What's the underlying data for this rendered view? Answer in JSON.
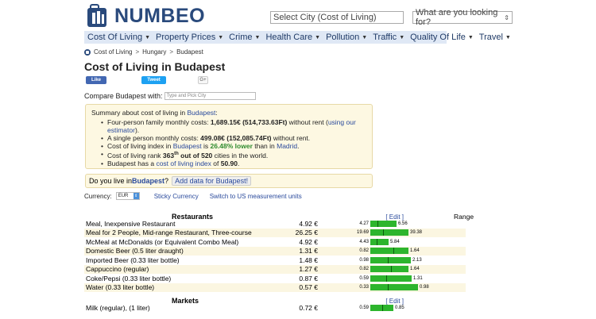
{
  "brand": {
    "logo_text": "NUMBEO",
    "color": "#2a4a7c"
  },
  "search": {
    "city_placeholder": "Select City (Cost of Living)",
    "site_placeholder": "What are you looking for?"
  },
  "nav": [
    {
      "label": "Cost Of Living",
      "icon": "caret-down"
    },
    {
      "label": "Property Prices",
      "icon": "caret-down"
    },
    {
      "label": "Crime",
      "icon": "caret-down"
    },
    {
      "label": "Health Care",
      "icon": "caret-down"
    },
    {
      "label": "Pollution",
      "icon": "caret-down"
    },
    {
      "label": "Traffic",
      "icon": "caret-down"
    },
    {
      "label": "Quality Of Life",
      "icon": "caret-down"
    },
    {
      "label": "Travel",
      "icon": "caret-down"
    }
  ],
  "breadcrumb": [
    "Cost of Living",
    "Hungary",
    "Budapest"
  ],
  "page_title": "Cost of Living in Budapest",
  "social": {
    "like": "Like",
    "tweet": "Tweet",
    "gplus": "G+"
  },
  "compare": {
    "label": "Compare Budapest with:",
    "placeholder": "Type and Pick City"
  },
  "summary": {
    "head_prefix": "Summary about cost of living in ",
    "city": "Budapest",
    "head_suffix": ":",
    "family_prefix": "Four-person family monthly costs: ",
    "family_value": "1,689.15€ (514,733.63Ft)",
    "family_mid": " without rent (",
    "family_link": "using our estimator",
    "family_suffix": ").",
    "single_prefix": "A single person monthly costs: ",
    "single_value": "499.08€ (152,085.74Ft)",
    "single_suffix": " without rent.",
    "index_prefix": "Cost of living index in ",
    "index_mid": " is ",
    "index_value": "26.48% lower",
    "index_than": " than in ",
    "index_compare_city": "Madrid",
    "index_suffix": ".",
    "rank_prefix": "Cost of living rank ",
    "rank_value": "363",
    "rank_sup": "th",
    "rank_out": " out of 520",
    "rank_suffix": " cities in the world.",
    "has_prefix": " has a ",
    "has_link": "cost of living index",
    "has_of": " of ",
    "has_value": "50.90",
    "has_suffix": "."
  },
  "live": {
    "prefix": "Do you live in ",
    "city": "Budapest",
    "q": "?",
    "button": "Add data for Budapest!"
  },
  "currency": {
    "label": "Currency:",
    "value": "EUR",
    "sticky": "Sticky Currency",
    "switch": "Switch to US measurement units"
  },
  "table": {
    "range_header": "Range",
    "edit_label": "[ Edit ]",
    "sections": [
      {
        "title": "Restaurants",
        "rows": [
          {
            "name": "Meal, Inexpensive Restaurant",
            "price": "4.92 €",
            "min": "4.27",
            "max": "6.56",
            "min_v": 4.27,
            "max_v": 6.56,
            "avg_v": 4.92
          },
          {
            "name": "Meal for 2 People, Mid-range Restaurant, Three-course",
            "price": "26.25 €",
            "min": "19.69",
            "max": "39.38",
            "min_v": 19.69,
            "max_v": 39.38,
            "avg_v": 26.25
          },
          {
            "name": "McMeal at McDonalds (or Equivalent Combo Meal)",
            "price": "4.92 €",
            "min": "4.43",
            "max": "5.84",
            "min_v": 4.43,
            "max_v": 5.84,
            "avg_v": 4.92
          },
          {
            "name": "Domestic Beer (0.5 liter draught)",
            "price": "1.31 €",
            "min": "0.82",
            "max": "1.64",
            "min_v": 0.82,
            "max_v": 1.64,
            "avg_v": 1.31
          },
          {
            "name": "Imported Beer (0.33 liter bottle)",
            "price": "1.48 €",
            "min": "0.98",
            "max": "2.13",
            "min_v": 0.98,
            "max_v": 2.13,
            "avg_v": 1.48
          },
          {
            "name": "Cappuccino (regular)",
            "price": "1.27 €",
            "min": "0.82",
            "max": "1.64",
            "min_v": 0.82,
            "max_v": 1.64,
            "avg_v": 1.27
          },
          {
            "name": "Coke/Pepsi (0.33 liter bottle)",
            "price": "0.87 €",
            "min": "0.59",
            "max": "1.31",
            "min_v": 0.59,
            "max_v": 1.31,
            "avg_v": 0.87
          },
          {
            "name": "Water (0.33 liter bottle)",
            "price": "0.57 €",
            "min": "0.33",
            "max": "0.98",
            "min_v": 0.33,
            "max_v": 0.98,
            "avg_v": 0.57
          }
        ]
      },
      {
        "title": "Markets",
        "rows": [
          {
            "name": "Milk (regular), (1 liter)",
            "price": "0.72 €",
            "min": "0.59",
            "max": "0.85",
            "min_v": 0.59,
            "max_v": 0.85,
            "avg_v": 0.72
          }
        ]
      }
    ]
  }
}
